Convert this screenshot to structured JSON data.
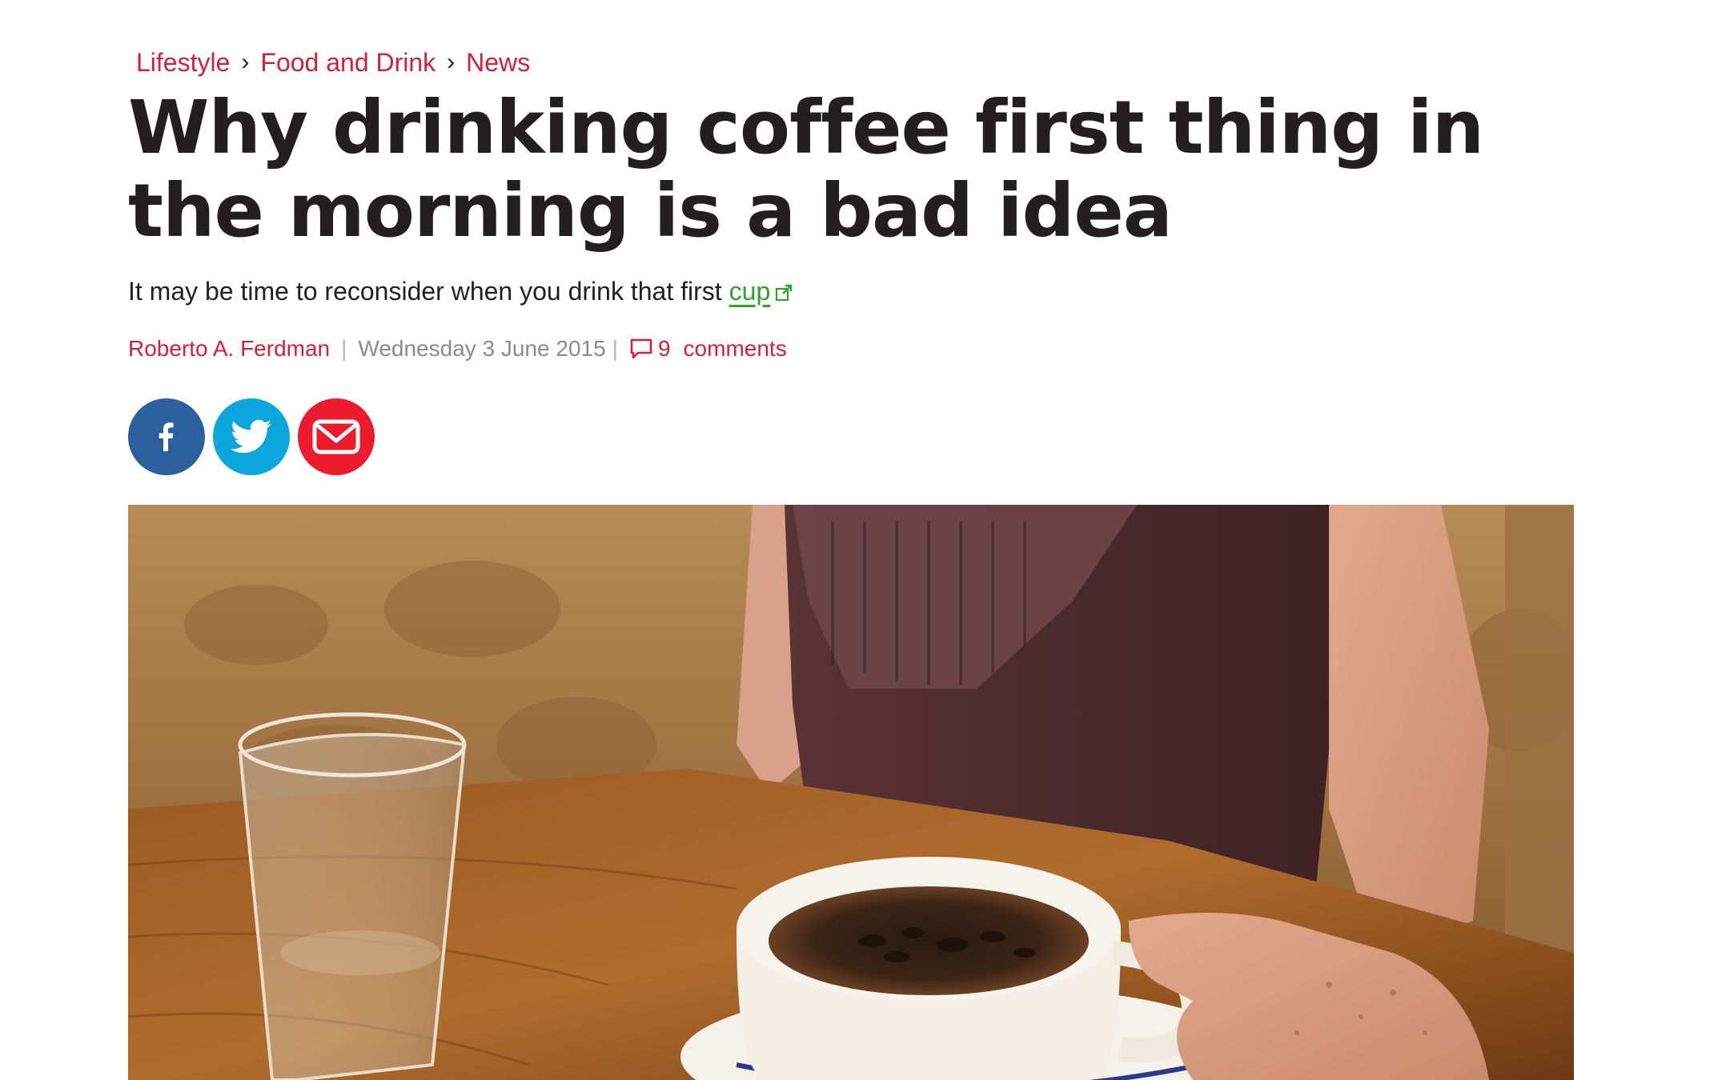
{
  "breadcrumb": {
    "items": [
      {
        "label": "Lifestyle"
      },
      {
        "label": "Food and Drink"
      },
      {
        "label": "News"
      }
    ],
    "separator": "›"
  },
  "headline": "Why drinking coffee first thing in the morning is a bad idea",
  "standfirst": {
    "text": "It may be time to reconsider when you drink that first",
    "link_label": "cup"
  },
  "byline": {
    "author": "Roberto A. Ferdman",
    "date": "Wednesday 3 June 2015",
    "comment_count": "9",
    "comments_label": "comments"
  },
  "share": {
    "buttons": [
      {
        "name": "facebook",
        "icon": "facebook-icon",
        "color": "#2c5f9e"
      },
      {
        "name": "twitter",
        "icon": "twitter-icon",
        "color": "#0aa6dc"
      },
      {
        "name": "email",
        "icon": "email-icon",
        "color": "#ec1c2e"
      }
    ]
  },
  "colors": {
    "accent": "#d71f36",
    "link_green": "#2aa52a",
    "text": "#231f20",
    "muted": "#8a8a8a"
  }
}
